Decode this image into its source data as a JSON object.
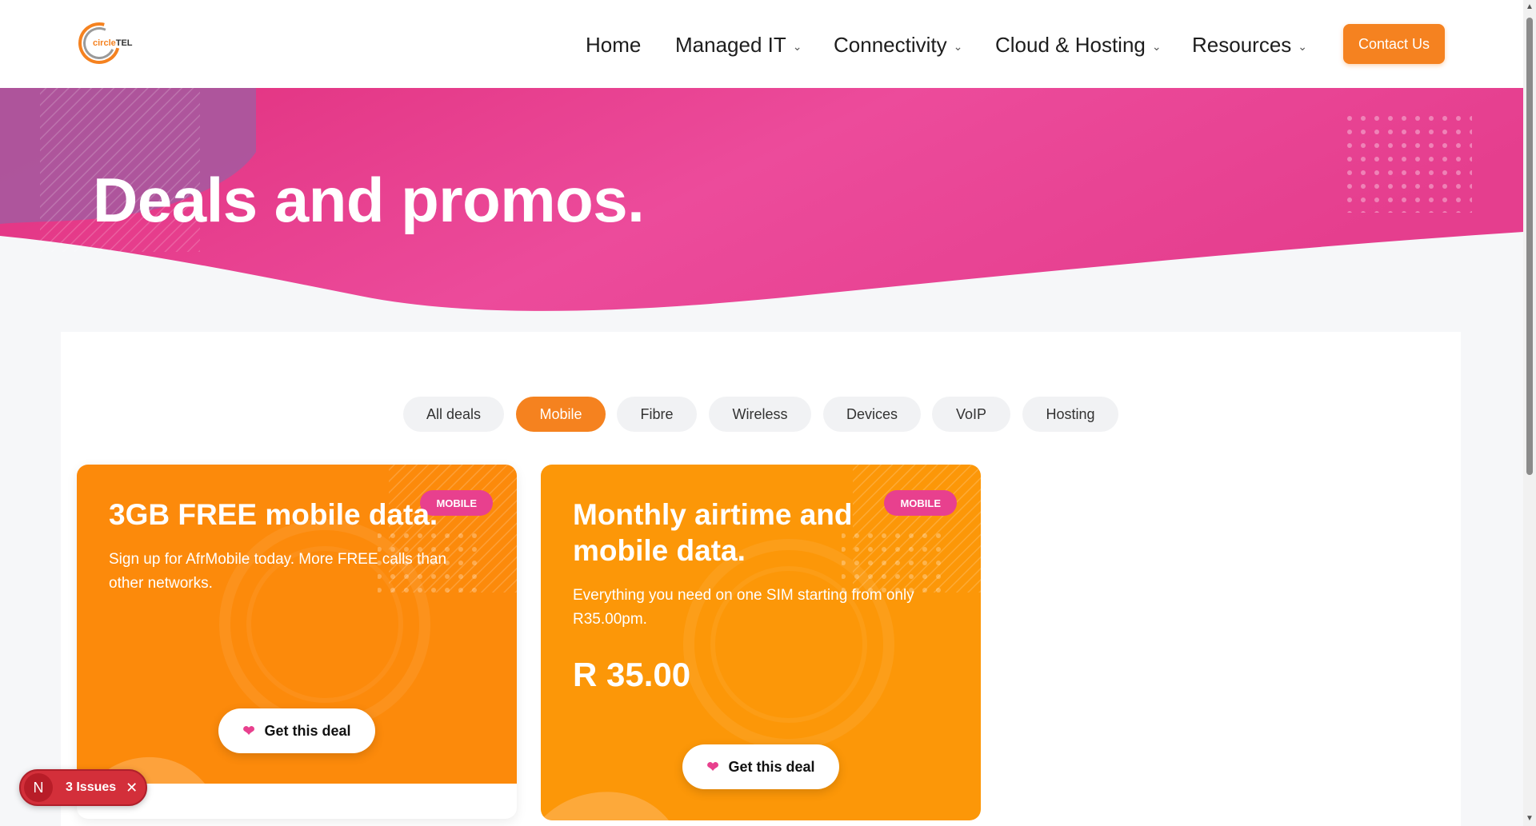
{
  "brand": {
    "logo_text_part1": "circle",
    "logo_text_part2": "TEL",
    "accent_color": "#f58220",
    "pink_color": "#e8408e"
  },
  "nav": {
    "home": "Home",
    "managed_it": "Managed IT",
    "connectivity": "Connectivity",
    "cloud_hosting": "Cloud & Hosting",
    "resources": "Resources",
    "contact": "Contact Us"
  },
  "hero": {
    "title": "Deals and promos."
  },
  "filters": {
    "items": [
      {
        "label": "All deals",
        "active": false
      },
      {
        "label": "Mobile",
        "active": true
      },
      {
        "label": "Fibre",
        "active": false
      },
      {
        "label": "Wireless",
        "active": false
      },
      {
        "label": "Devices",
        "active": false
      },
      {
        "label": "VoIP",
        "active": false
      },
      {
        "label": "Hosting",
        "active": false
      }
    ]
  },
  "cards": [
    {
      "badge": "MOBILE",
      "title": "3GB FREE mobile data.",
      "description": "Sign up for AfrMobile today. More FREE calls than other networks.",
      "button": "Get this deal"
    },
    {
      "badge": "MOBILE",
      "title": "Monthly airtime and mobile data.",
      "description": "Everything you need on one SIM starting from only R35.00pm.",
      "price": "R 35.00",
      "button": "Get this deal"
    }
  ],
  "issues": {
    "avatar": "N",
    "label": "3 Issues"
  }
}
